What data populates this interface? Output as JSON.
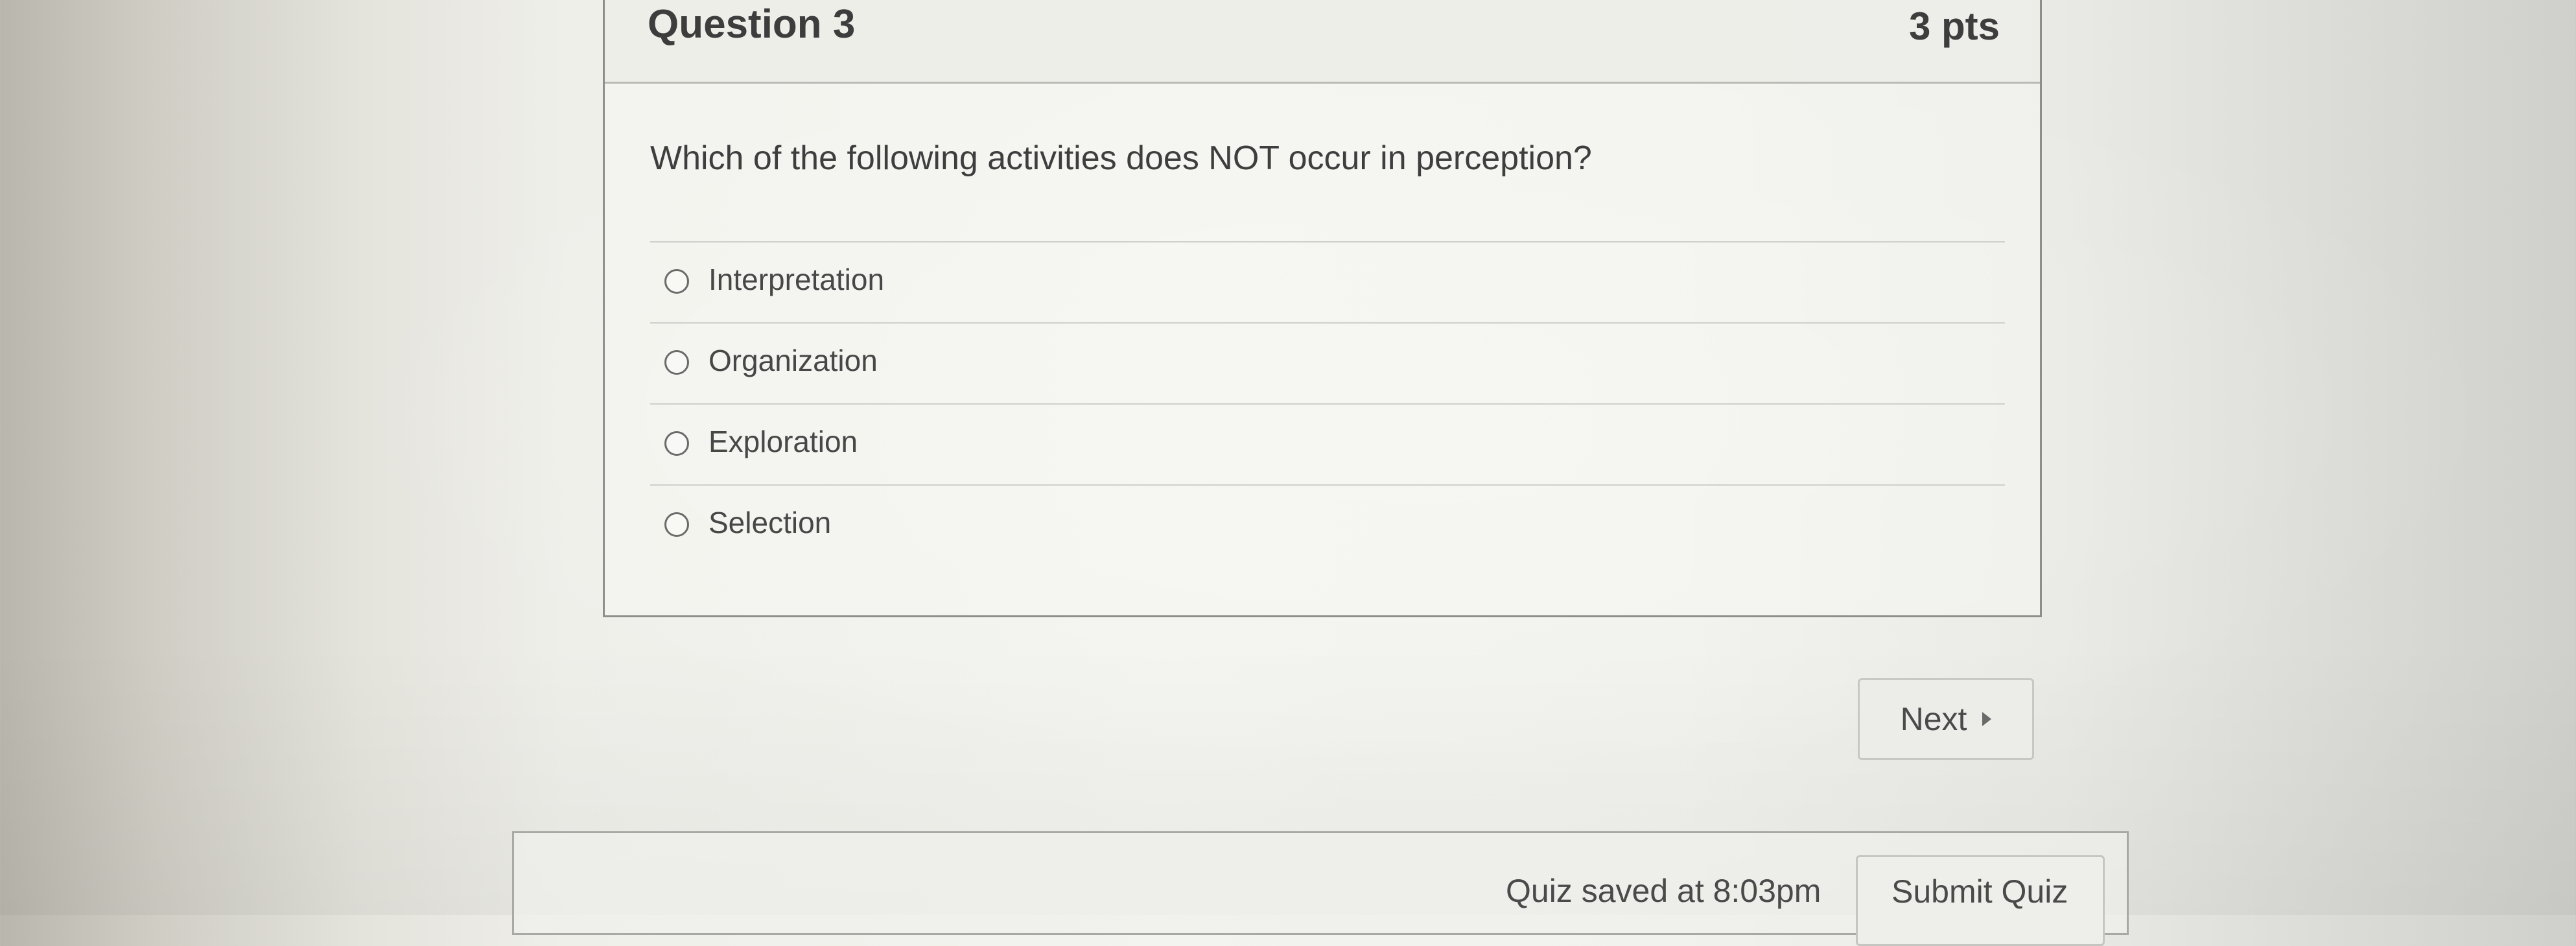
{
  "question": {
    "title": "Question 3",
    "points": "3 pts",
    "text": "Which of the following activities does NOT occur in perception?",
    "answers": [
      {
        "label": "Interpretation",
        "selected": false
      },
      {
        "label": "Organization",
        "selected": false
      },
      {
        "label": "Exploration",
        "selected": false
      },
      {
        "label": "Selection",
        "selected": false
      }
    ]
  },
  "navigation": {
    "next_label": "Next",
    "next_icon": "triangle-right-icon"
  },
  "footer": {
    "saved_status": "Quiz saved at 8:03pm",
    "submit_label": "Submit Quiz"
  },
  "colors": {
    "text": "#404040",
    "border": "#8e8e8a",
    "divider": "#cfcfcb"
  }
}
